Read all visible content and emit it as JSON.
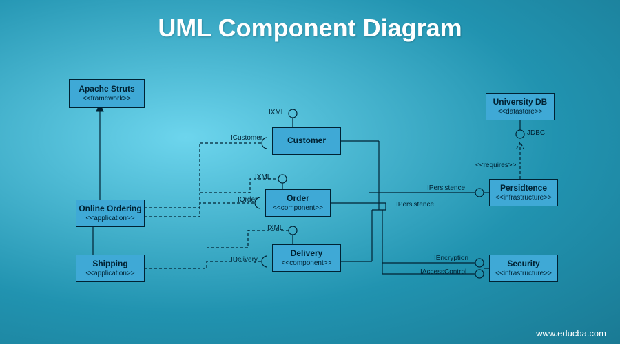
{
  "title": "UML Component Diagram",
  "footer": "www.educba.com",
  "boxes": {
    "apache": {
      "name": "Apache Struts",
      "stereo": "<<framework>>"
    },
    "ordering": {
      "name": "Online Ordering",
      "stereo": "<<application>>"
    },
    "shipping": {
      "name": "Shipping",
      "stereo": "<<application>>"
    },
    "customer": {
      "name": "Customer",
      "stereo": ""
    },
    "order": {
      "name": "Order",
      "stereo": "<<component>>"
    },
    "delivery": {
      "name": "Delivery",
      "stereo": "<<component>>"
    },
    "university": {
      "name": "University DB",
      "stereo": "<<datastore>>"
    },
    "persist": {
      "name": "Persidtence",
      "stereo": "<<infrastructure>>"
    },
    "security": {
      "name": "Security",
      "stereo": "<<infrastructure>>"
    }
  },
  "labels": {
    "ixml1": "IXML",
    "ixml2": "IXML",
    "ixml3": "IXML",
    "icustomer": "ICustomer",
    "iorder": "IOrder",
    "idelivery": "IDelivery",
    "ipersist1": "IPersistence",
    "ipersist2": "IPersistence",
    "iencrypt": "IEncryption",
    "iaccess": "IAccessControl",
    "jdbc": "JDBC",
    "requires": "<<requires>>"
  }
}
